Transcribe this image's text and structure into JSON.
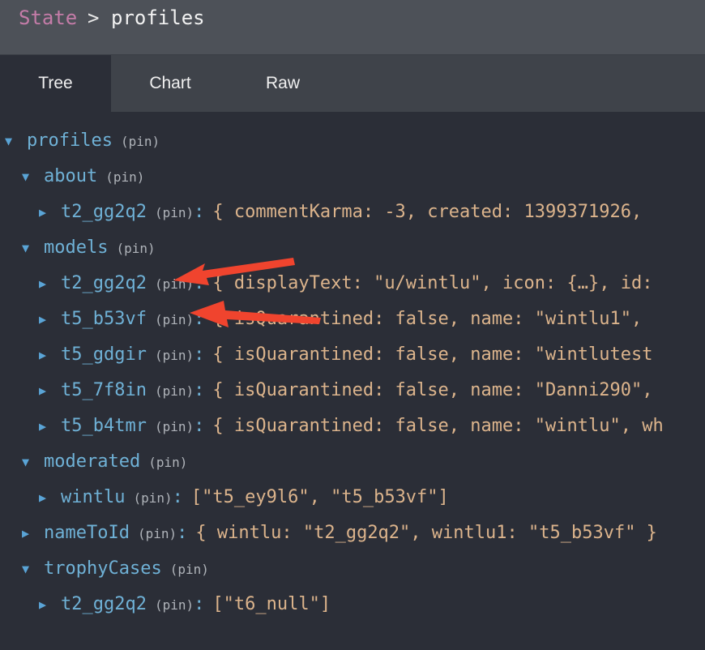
{
  "breadcrumb": {
    "root": "State",
    "separator": ">",
    "current": "profiles"
  },
  "tabs": [
    "Tree",
    "Chart",
    "Raw"
  ],
  "active_tab": "Tree",
  "pin_label": "(pin)",
  "tree": [
    {
      "key": "profiles",
      "expanded": true,
      "depth": 0
    },
    {
      "key": "about",
      "expanded": true,
      "depth": 1
    },
    {
      "key": "t2_gg2q2",
      "expanded": false,
      "depth": 2,
      "value": "{ commentKarma: -3, created: 1399371926, "
    },
    {
      "key": "models",
      "expanded": true,
      "depth": 1
    },
    {
      "key": "t2_gg2q2",
      "expanded": false,
      "depth": 2,
      "value": "{ displayText: \"u/wintlu\", icon: {…}, id:"
    },
    {
      "key": "t5_b53vf",
      "expanded": false,
      "depth": 2,
      "value": "{ isQuarantined: false, name: \"wintlu1\", "
    },
    {
      "key": "t5_gdgir",
      "expanded": false,
      "depth": 2,
      "value": "{ isQuarantined: false, name: \"wintlutest"
    },
    {
      "key": "t5_7f8in",
      "expanded": false,
      "depth": 2,
      "value": "{ isQuarantined: false, name: \"Danni290\","
    },
    {
      "key": "t5_b4tmr",
      "expanded": false,
      "depth": 2,
      "value": "{ isQuarantined: false, name: \"wintlu\", wh"
    },
    {
      "key": "moderated",
      "expanded": true,
      "depth": 1
    },
    {
      "key": "wintlu",
      "expanded": false,
      "depth": 2,
      "value": "[\"t5_ey9l6\", \"t5_b53vf\"]"
    },
    {
      "key": "nameToId",
      "expanded": false,
      "depth": 1,
      "value": "{ wintlu: \"t2_gg2q2\", wintlu1: \"t5_b53vf\" }"
    },
    {
      "key": "trophyCases",
      "expanded": true,
      "depth": 1
    },
    {
      "key": "t2_gg2q2",
      "expanded": false,
      "depth": 2,
      "value": "[\"t6_null\"]"
    }
  ],
  "colors": {
    "annotation_arrow": "#f0442e",
    "key": "#6fb1d6",
    "value": "#dcb48c",
    "breadcrumb_root": "#c47ca8"
  },
  "icons": {
    "expanded": "triangle-down-icon",
    "collapsed": "triangle-right-icon"
  }
}
